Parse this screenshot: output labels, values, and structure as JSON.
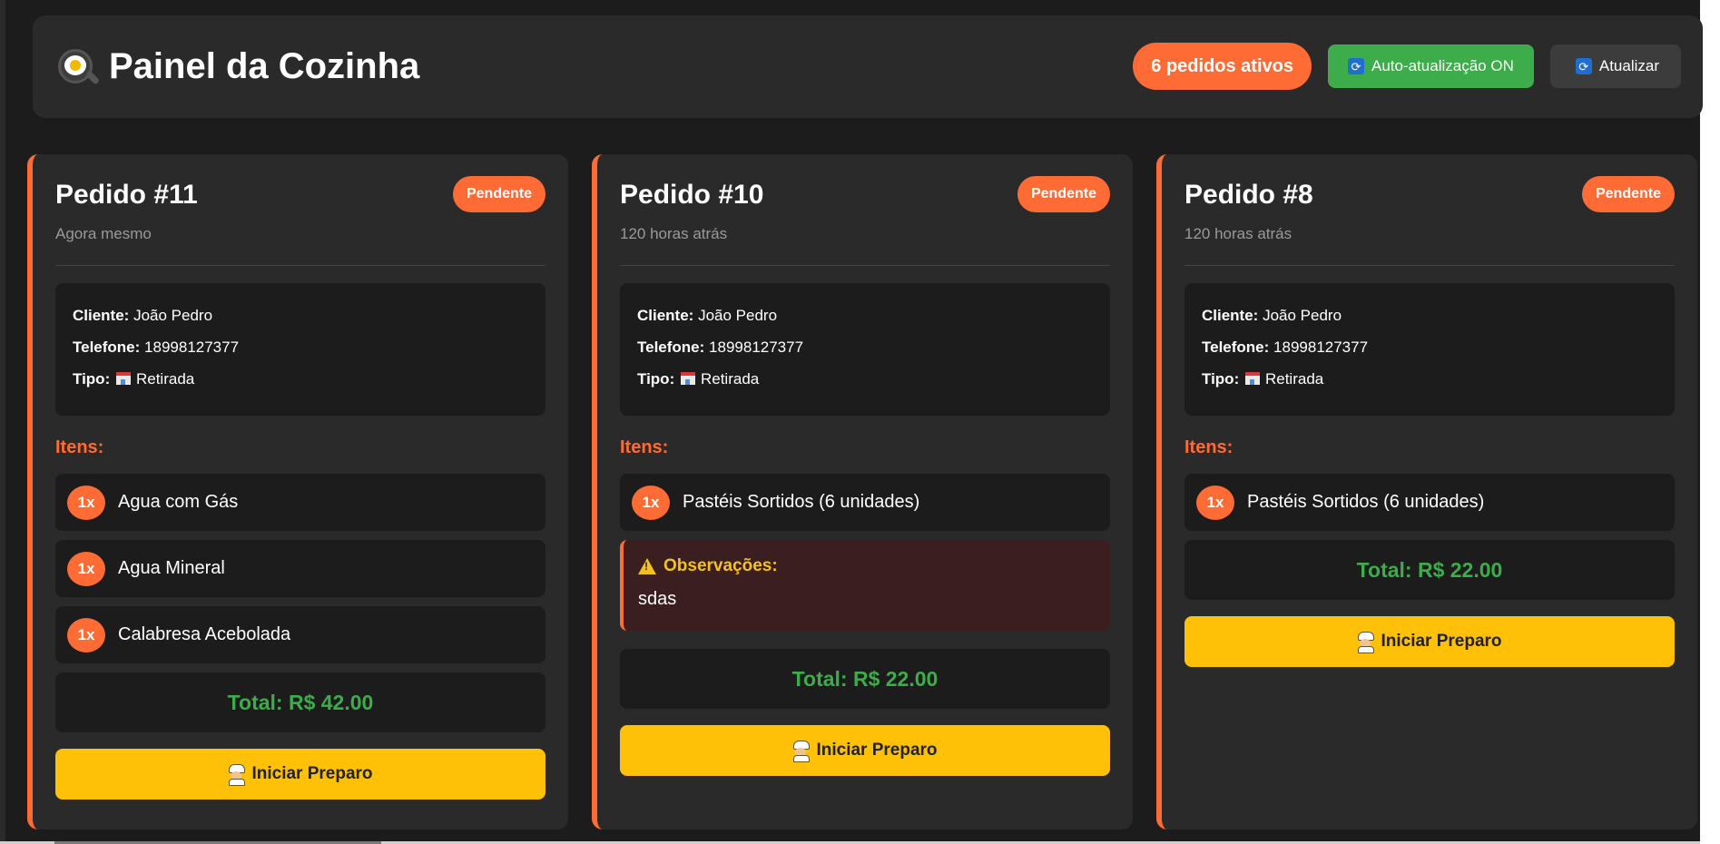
{
  "header": {
    "title": "Painel da Cozinha",
    "active_count": "6 pedidos ativos",
    "auto_refresh_label": "Auto-atualização ON",
    "refresh_label": "Atualizar"
  },
  "colors": {
    "accent": "#ff6b35",
    "success": "#3dac4a",
    "warning": "#ffc107",
    "background": "#1c1c1c",
    "card": "#2a2a2a"
  },
  "labels": {
    "client": "Cliente:",
    "phone": "Telefone:",
    "type": "Tipo:",
    "items": "Itens:",
    "observations": "Observações:",
    "start_button": "Iniciar Preparo"
  },
  "orders": [
    {
      "title": "Pedido #11",
      "time": "Agora mesmo",
      "status": "Pendente",
      "client": "João Pedro",
      "phone": "18998127377",
      "type": "Retirada",
      "items": [
        {
          "qty": "1x",
          "name": "Agua com Gás"
        },
        {
          "qty": "1x",
          "name": "Agua Mineral"
        },
        {
          "qty": "1x",
          "name": "Calabresa Acebolada"
        }
      ],
      "total": "Total: R$ 42.00"
    },
    {
      "title": "Pedido #10",
      "time": "120 horas atrás",
      "status": "Pendente",
      "client": "João Pedro",
      "phone": "18998127377",
      "type": "Retirada",
      "items": [
        {
          "qty": "1x",
          "name": "Pastéis Sortidos (6 unidades)"
        }
      ],
      "observations": "sdas",
      "total": "Total: R$ 22.00"
    },
    {
      "title": "Pedido #8",
      "time": "120 horas atrás",
      "status": "Pendente",
      "client": "João Pedro",
      "phone": "18998127377",
      "type": "Retirada",
      "items": [
        {
          "qty": "1x",
          "name": "Pastéis Sortidos (6 unidades)"
        }
      ],
      "total": "Total: R$ 22.00"
    }
  ]
}
